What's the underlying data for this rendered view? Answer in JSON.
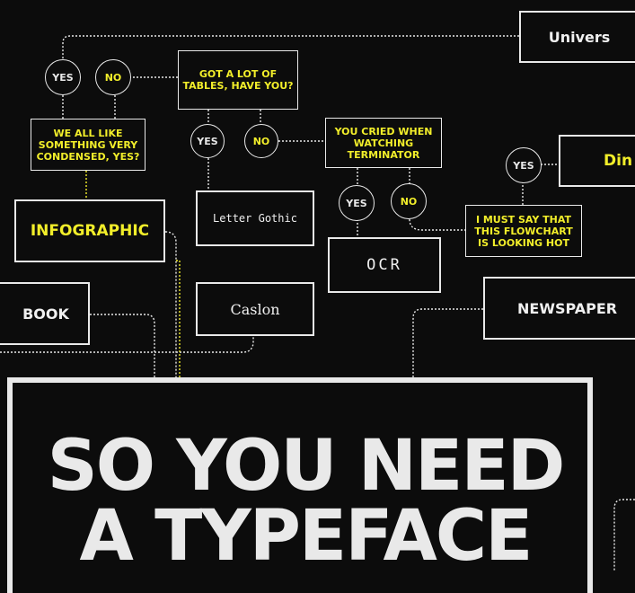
{
  "title": {
    "line1": "SO YOU NEED",
    "line2": "A TYPEFACE"
  },
  "colors": {
    "background": "#0c0c0c",
    "line": "#e9e9e9",
    "accent_yellow": "#f2ee2a"
  },
  "typefaces": {
    "univers": "Univers",
    "din": "Din",
    "infographic": "INFOGRAPHIC",
    "letter_gothic": "Letter Gothic",
    "ocr": "OCR",
    "book": "BOOK",
    "caslon": "Caslon",
    "newspaper": "NEWSPAPER"
  },
  "questions": {
    "tables": "GOT A LOT OF TABLES, HAVE YOU?",
    "condensed": "WE ALL LIKE SOMETHING VERY CONDENSED, YES?",
    "terminator": "YOU CRIED WHEN WATCHING TERMINATOR",
    "flowchart": "I MUST SAY THAT THIS FLOWCHART IS LOOKING HOT"
  },
  "answers": {
    "yes": "YES",
    "no": "NO"
  }
}
